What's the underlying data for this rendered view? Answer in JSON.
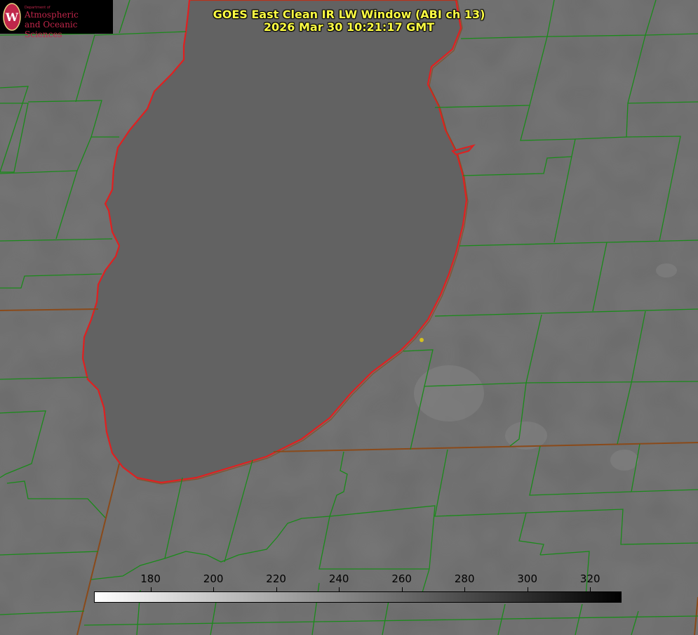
{
  "title": {
    "line1": "GOES East Clean IR LW Window (ABI ch 13)",
    "line2": "2026 Mar 30 10:21:17 GMT"
  },
  "logo": {
    "dept": "Department of",
    "line1": "Atmospheric",
    "line2": "and Oceanic Sciences",
    "seal_letter": "W"
  },
  "colorbar": {
    "min": 162,
    "max": 330,
    "ticks": [
      180,
      200,
      220,
      240,
      260,
      280,
      300,
      320
    ],
    "gradient_from": "#ffffff",
    "gradient_to": "#000000"
  },
  "colors": {
    "county_lines": "#1a8a1a",
    "state_lines": "#8a4a1a",
    "lake_outline": "#e02020",
    "title_text": "#ffff44",
    "marker": "#d4c020"
  }
}
